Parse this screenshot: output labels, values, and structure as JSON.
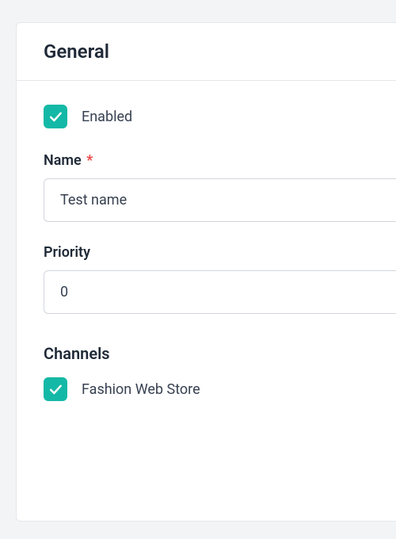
{
  "general": {
    "title": "General",
    "enabled": {
      "label": "Enabled",
      "checked": true
    },
    "name": {
      "label": "Name",
      "required_mark": "*",
      "value": "Test name"
    },
    "priority": {
      "label": "Priority",
      "value": "0"
    },
    "channels": {
      "heading": "Channels",
      "items": [
        {
          "label": "Fashion Web Store",
          "checked": true
        }
      ]
    }
  },
  "colors": {
    "accent": "#14b8a6",
    "text": "#1f2937",
    "border": "#d1d5db",
    "required": "#ef4444"
  }
}
